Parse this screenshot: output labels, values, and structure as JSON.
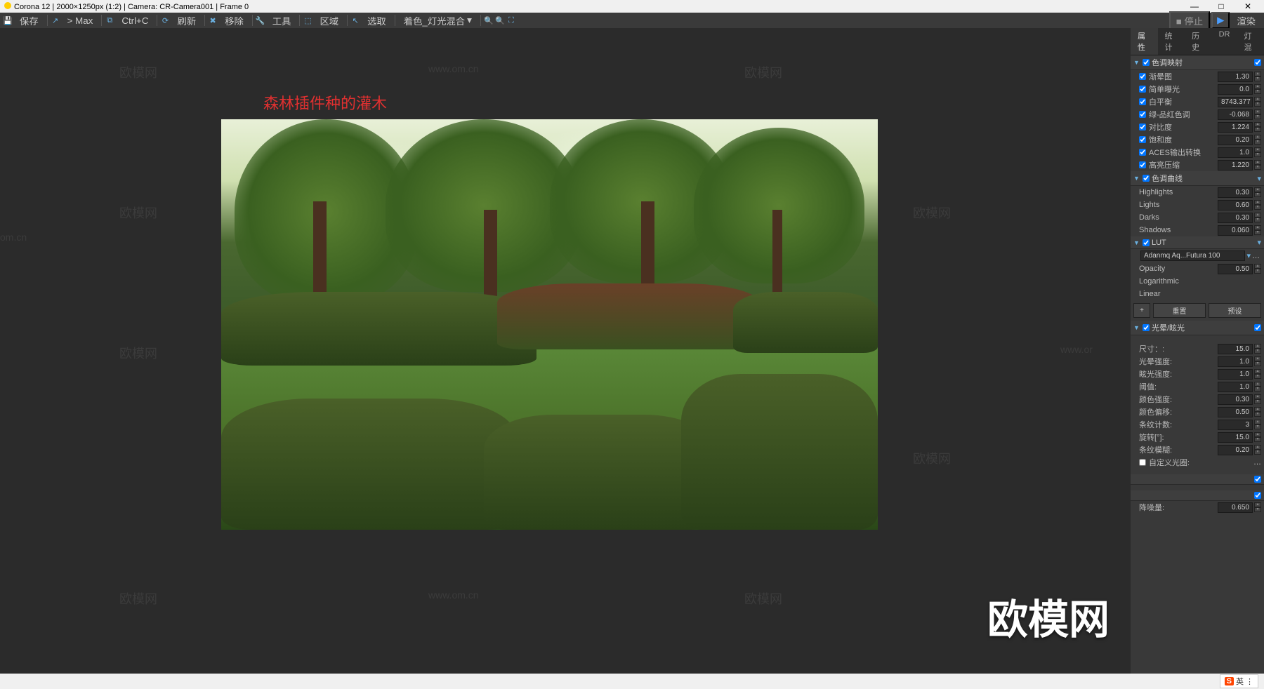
{
  "title": "Corona 12 | 2000×1250px (1:2) | Camera: CR-Camera001 | Frame 0",
  "toolbar": {
    "save": "保存",
    "max": "> Max",
    "ctrlc": "Ctrl+C",
    "refresh": "刷新",
    "remove": "移除",
    "tools": "工具",
    "region": "区域",
    "select": "选取",
    "colormix": "着色_灯光混合"
  },
  "topright": {
    "stop": "停止",
    "render": "渲染"
  },
  "overlay": "森林插件种的灌木",
  "watermarks": {
    "brand": "欧模网",
    "url": "www.om.cn",
    "biglogo": "欧模网"
  },
  "tabs": [
    "属性",
    "统计",
    "历史",
    "DR",
    "灯混"
  ],
  "sec_tonemap": "色调映射",
  "props_tone": [
    {
      "name": "渐晕图",
      "val": "1.30",
      "chk": true
    },
    {
      "name": "简单曝光",
      "val": "0.0",
      "chk": true
    },
    {
      "name": "白平衡",
      "val": "8743.377",
      "chk": true
    },
    {
      "name": "绿-品红色调",
      "val": "-0.068",
      "chk": true
    },
    {
      "name": "对比度",
      "val": "1.224",
      "chk": true
    },
    {
      "name": "饱和度",
      "val": "0.20",
      "chk": true
    },
    {
      "name": "ACES输出转换",
      "val": "1.0",
      "chk": true
    },
    {
      "name": "高亮压缩",
      "val": "1.220",
      "chk": true
    }
  ],
  "sec_curve": "色调曲线",
  "props_curve": [
    {
      "name": "Highlights",
      "val": "0.30"
    },
    {
      "name": "Lights",
      "val": "0.60"
    },
    {
      "name": "Darks",
      "val": "0.30"
    },
    {
      "name": "Shadows",
      "val": "0.060"
    }
  ],
  "sec_lut": "LUT",
  "lut_name": "Adanmq Aq...Futura 100",
  "lut_opacity": {
    "name": "Opacity",
    "val": "0.50"
  },
  "lut_log": "Logarithmic",
  "lut_linear": "Linear",
  "btn_reset": "重置",
  "btn_preset": "预设",
  "sec_bloom": "光晕/眩光",
  "props_bloom": [
    {
      "name": "尺寸：:",
      "val": "15.0"
    },
    {
      "name": "光晕强度:",
      "val": "1.0"
    },
    {
      "name": "眩光强度:",
      "val": "1.0"
    },
    {
      "name": "阈值:",
      "val": "1.0"
    },
    {
      "name": "颜色强度:",
      "val": "0.30"
    },
    {
      "name": "颜色偏移:",
      "val": "0.50"
    },
    {
      "name": "条纹计数:",
      "val": "3"
    },
    {
      "name": "旋转[°]:",
      "val": "15.0"
    },
    {
      "name": "条纹模糊:",
      "val": "0.20"
    }
  ],
  "custom_aperture": "自定义光圈:",
  "denoise": {
    "name": "降噪量:",
    "val": "0.650"
  },
  "ime_lang": "英"
}
